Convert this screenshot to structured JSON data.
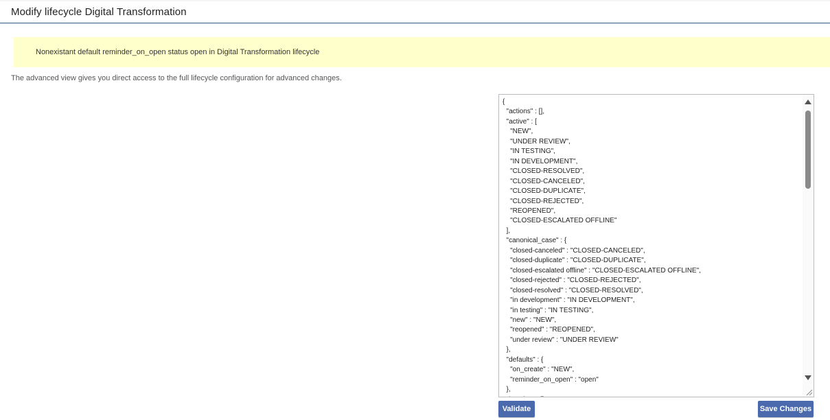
{
  "header": {
    "title": "Modify lifecycle Digital Transformation"
  },
  "alert": {
    "message": "Nonexistant default reminder_on_open status open in Digital Transformation lifecycle",
    "color": "#ffffcc"
  },
  "description": "The advanced view gives you direct access to the full lifecycle configuration for advanced changes.",
  "editor": {
    "visible_lines": [
      "{",
      "  \"actions\" : [],",
      "  \"active\" : [",
      "    \"NEW\",",
      "    \"UNDER REVIEW\",",
      "    \"IN TESTING\",",
      "    \"IN DEVELOPMENT\",",
      "    \"CLOSED-RESOLVED\",",
      "    \"CLOSED-CANCELED\",",
      "    \"CLOSED-DUPLICATE\",",
      "    \"CLOSED-REJECTED\",",
      "    \"REOPENED\",",
      "    \"CLOSED-ESCALATED OFFLINE\"",
      "  ],",
      "  \"canonical_case\" : {",
      "    \"closed-canceled\" : \"CLOSED-CANCELED\",",
      "    \"closed-duplicate\" : \"CLOSED-DUPLICATE\",",
      "    \"closed-escalated offline\" : \"CLOSED-ESCALATED OFFLINE\",",
      "    \"closed-rejected\" : \"CLOSED-REJECTED\",",
      "    \"closed-resolved\" : \"CLOSED-RESOLVED\",",
      "    \"in development\" : \"IN DEVELOPMENT\",",
      "    \"in testing\" : \"IN TESTING\",",
      "    \"new\" : \"NEW\",",
      "    \"reopened\" : \"REOPENED\",",
      "    \"under review\" : \"UNDER REVIEW\"",
      "  },",
      "  \"defaults\" : {",
      "    \"on_create\" : \"NEW\",",
      "    \"reminder_on_open\" : \"open\"",
      "  },",
      "  \"inactive\" : [],"
    ]
  },
  "buttons": {
    "validate_label": "Validate",
    "save_label": "Save Changes",
    "color": "#4a6aad"
  }
}
